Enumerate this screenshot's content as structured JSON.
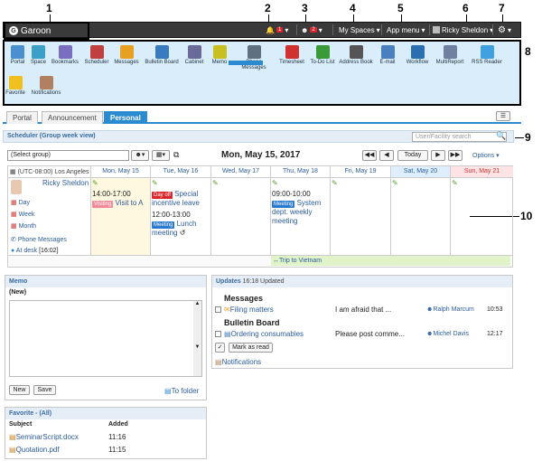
{
  "callouts": [
    "1",
    "2",
    "3",
    "4",
    "5",
    "6",
    "7",
    "8",
    "9",
    "10"
  ],
  "header": {
    "app_name": "Garoon",
    "notif_count": "1",
    "presence_count": "2",
    "my_spaces": "My Spaces",
    "app_menu": "App menu",
    "user": "Ricky Sheldon"
  },
  "apps": [
    {
      "label": "Portal",
      "color": "#4a8fd0"
    },
    {
      "label": "Space",
      "color": "#3aa0c8"
    },
    {
      "label": "Bookmarks",
      "color": "#7a6ec0"
    },
    {
      "label": "Scheduler",
      "color": "#c04040"
    },
    {
      "label": "Messages",
      "color": "#e8a020"
    },
    {
      "label": "Bulletin Board",
      "color": "#3a7abf"
    },
    {
      "label": "Cabinet",
      "color": "#6a6a9a"
    },
    {
      "label": "Memo",
      "color": "#c8c020"
    },
    {
      "label": "Phone Messages",
      "color": "#607080"
    },
    {
      "label": "Timesheet",
      "color": "#d03030"
    },
    {
      "label": "To-Do List",
      "color": "#3a9a3a"
    },
    {
      "label": "Address Book",
      "color": "#555"
    },
    {
      "label": "E-mail",
      "color": "#4a80c0"
    },
    {
      "label": "Workflow",
      "color": "#2a70b0"
    },
    {
      "label": "MultiReport",
      "color": "#7080a0"
    },
    {
      "label": "RSS Reader",
      "color": "#40a0e0"
    },
    {
      "label": "Favorite",
      "color": "#f0c020"
    },
    {
      "label": "Notifications",
      "color": "#b08060"
    }
  ],
  "tabs": [
    "Portal",
    "Announcement",
    "Personal"
  ],
  "scheduler": {
    "title": "Scheduler (Group week view)",
    "search_placeholder": "User/Facility search",
    "group": "(Select group)",
    "date": "Mon, May 15, 2017",
    "today": "Today",
    "options": "Options",
    "timezone": "(UTC-08:00) Los Angeles",
    "days": [
      "Mon, May 15",
      "Tue, May 16",
      "Wed, May 17",
      "Thu, May 18",
      "Fri, May 19",
      "Sat, May 20",
      "Sun, May 21"
    ],
    "user": "Ricky Sheldon",
    "links": [
      "Day",
      "Week",
      "Month",
      "Phone Messages"
    ],
    "status": "At desk",
    "status_time": "[16:02]",
    "mon_time": "14:00-17:00",
    "mon_tag": "Visiting",
    "mon_title": "Visit to A",
    "tue_tag": "Day off",
    "tue_title": "Special incentive leave",
    "tue_time": "12:00-13:00",
    "tue_tag2": "Meeting",
    "tue_title2": "Lunch meeting",
    "thu_time": "09:00-10:00",
    "thu_tag": "Meeting",
    "thu_title": "System dept. weekly meeting",
    "trip": "Trip to Vietnam"
  },
  "memo": {
    "title": "Memo",
    "sub": "(New)",
    "new_btn": "New",
    "save_btn": "Save",
    "folder": "To folder"
  },
  "favorite": {
    "title": "Favorite - (All)",
    "col_subject": "Subject",
    "col_added": "Added",
    "rows": [
      {
        "name": "SeminarScript.docx",
        "added": "11:16"
      },
      {
        "name": "Quotation.pdf",
        "added": "11:15"
      }
    ]
  },
  "updates": {
    "title": "Updates",
    "updated": "16:18 Updated",
    "sec1": "Messages",
    "sec2": "Bulletin Board",
    "rows": [
      {
        "title": "Filing matters",
        "preview": "I am afraid that ...",
        "user": "Ralph Marcum",
        "time": "10:53"
      },
      {
        "title": "Ordering consumables",
        "preview": "Please post comme...",
        "user": "Michel Davis",
        "time": "12:17"
      }
    ],
    "mark_read": "Mark as read",
    "notifications": "Notifications"
  }
}
